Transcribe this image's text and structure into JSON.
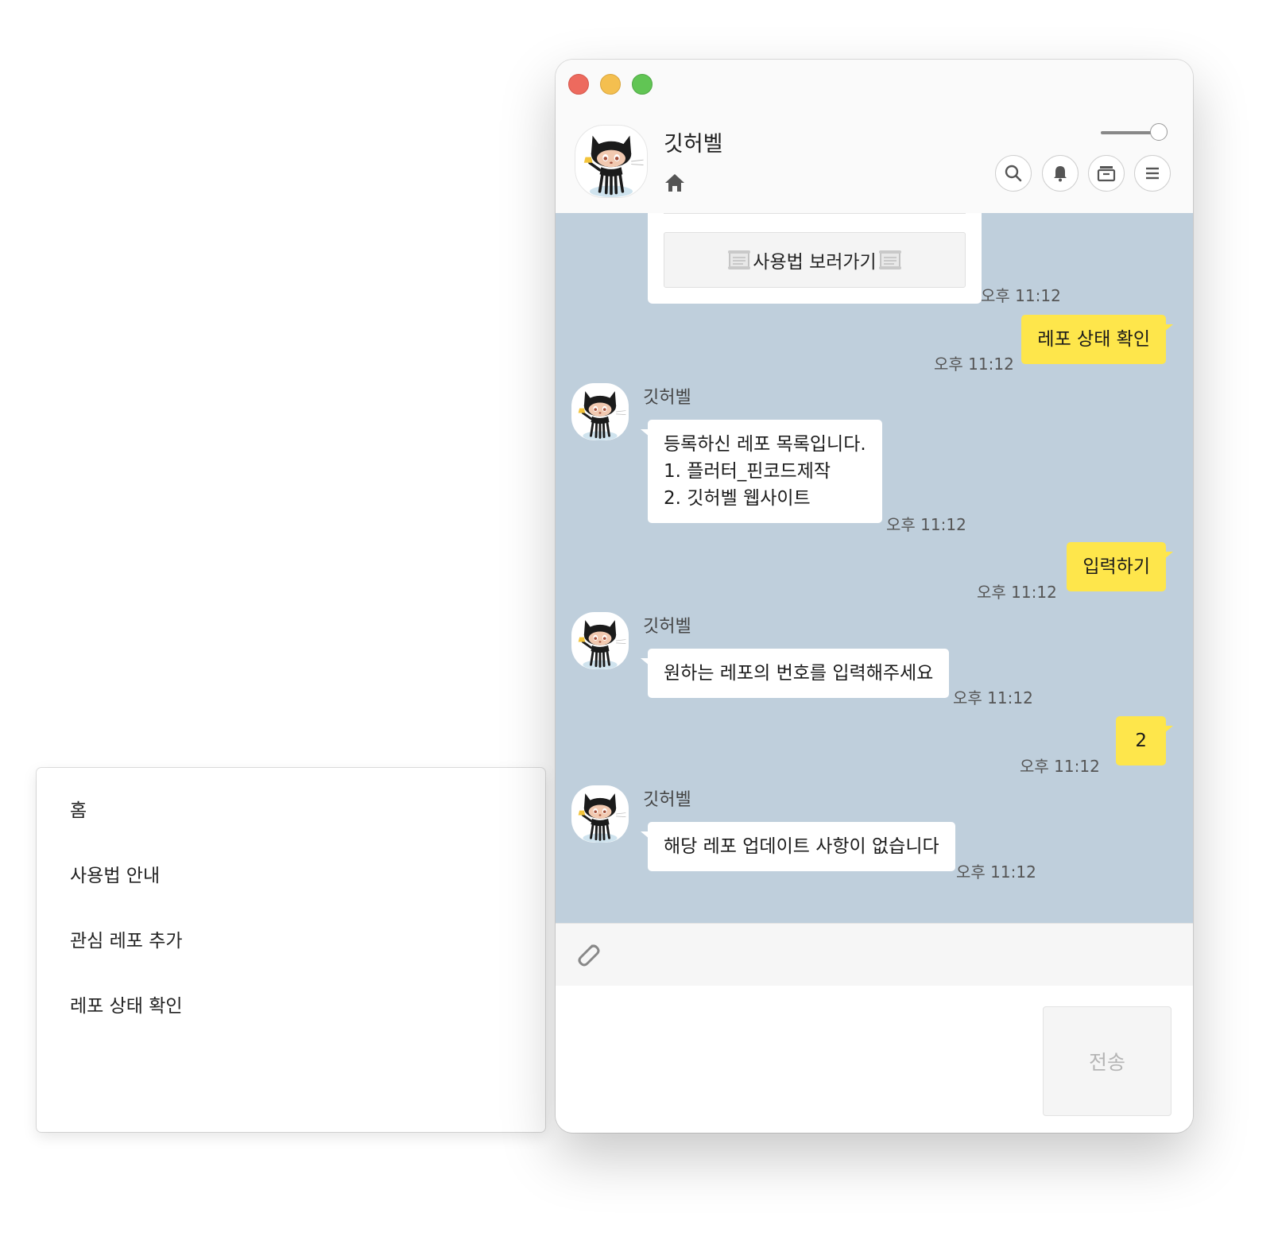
{
  "chat": {
    "title": "깃허벨",
    "card_button_label": "사용법 보러가기",
    "send_button": "전송",
    "message_input_placeholder": ""
  },
  "messages": [
    {
      "from": "bot",
      "time": "오후 11:12"
    },
    {
      "from": "me",
      "text": "레포 상태 확인",
      "time": "오후 11:12"
    },
    {
      "from": "bot",
      "sender": "깃허벨",
      "lines": [
        "등록하신 레포 목록입니다.",
        "1. 플러터_핀코드제작",
        "2. 깃허벨 웹사이트"
      ],
      "time": "오후 11:12"
    },
    {
      "from": "me",
      "text": "입력하기",
      "time": "오후 11:12"
    },
    {
      "from": "bot",
      "sender": "깃허벨",
      "text": "원하는 레포의 번호를 입력해주세요",
      "time": "오후 11:12"
    },
    {
      "from": "me",
      "text": "2",
      "time": "오후 11:12"
    },
    {
      "from": "bot",
      "sender": "깃허벨",
      "text": "해당 레포 업데이트 사항이 없습니다",
      "time": "오후 11:12"
    }
  ],
  "menu": {
    "items": [
      "홈",
      "사용법 안내",
      "관심 레포 추가",
      "레포 상태 확인"
    ]
  },
  "icons": {
    "header": [
      "home-icon",
      "search-icon",
      "bell-icon",
      "drawer-icon",
      "menu-icon"
    ],
    "toolbar": [
      "paperclip-icon"
    ]
  },
  "colors": {
    "chat_background": "#bfcfdc",
    "my_bubble": "#fee64b",
    "bot_bubble": "#ffffff"
  }
}
